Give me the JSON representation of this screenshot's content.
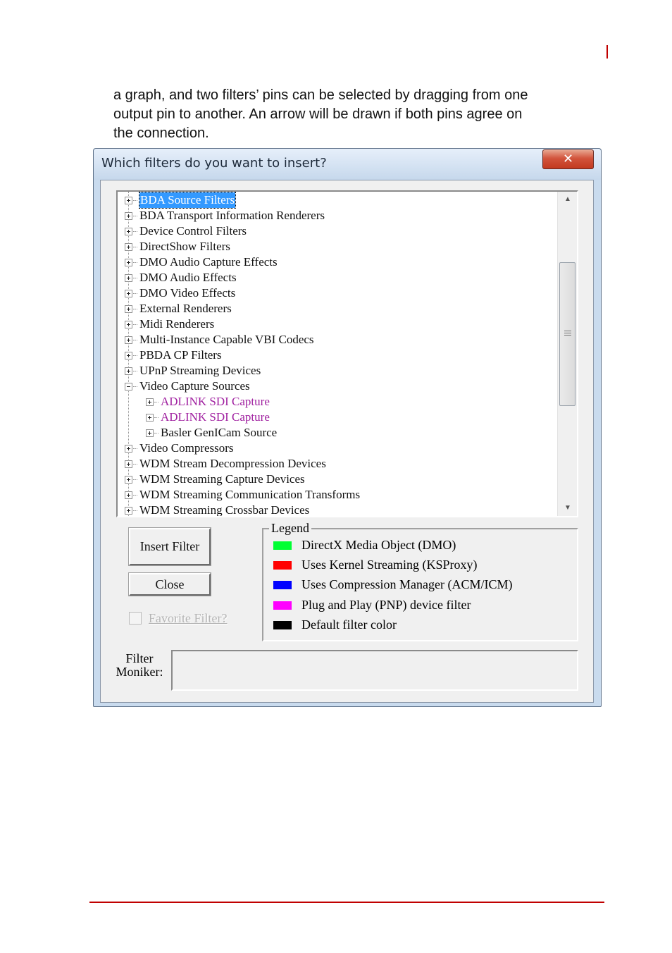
{
  "document": {
    "intro_lines": [
      "a graph, and two filters’ pins can be selected by dragging from one",
      "output pin to another. An arrow will be drawn if both pins agree on",
      "the connection."
    ]
  },
  "dialog": {
    "title": "Which filters do you want to insert?",
    "close_glyph": "✕",
    "tree": {
      "items": [
        {
          "label": "BDA Source Filters",
          "level": 0,
          "expander": "plus",
          "selected": true,
          "pnp": false
        },
        {
          "label": "BDA Transport Information Renderers",
          "level": 0,
          "expander": "plus",
          "selected": false,
          "pnp": false
        },
        {
          "label": "Device Control Filters",
          "level": 0,
          "expander": "plus",
          "selected": false,
          "pnp": false
        },
        {
          "label": "DirectShow Filters",
          "level": 0,
          "expander": "plus",
          "selected": false,
          "pnp": false
        },
        {
          "label": "DMO Audio Capture Effects",
          "level": 0,
          "expander": "plus",
          "selected": false,
          "pnp": false
        },
        {
          "label": "DMO Audio Effects",
          "level": 0,
          "expander": "plus",
          "selected": false,
          "pnp": false
        },
        {
          "label": "DMO Video Effects",
          "level": 0,
          "expander": "plus",
          "selected": false,
          "pnp": false
        },
        {
          "label": "External Renderers",
          "level": 0,
          "expander": "plus",
          "selected": false,
          "pnp": false
        },
        {
          "label": "Midi Renderers",
          "level": 0,
          "expander": "plus",
          "selected": false,
          "pnp": false
        },
        {
          "label": "Multi-Instance Capable VBI Codecs",
          "level": 0,
          "expander": "plus",
          "selected": false,
          "pnp": false
        },
        {
          "label": "PBDA CP Filters",
          "level": 0,
          "expander": "plus",
          "selected": false,
          "pnp": false
        },
        {
          "label": "UPnP Streaming Devices",
          "level": 0,
          "expander": "plus",
          "selected": false,
          "pnp": false
        },
        {
          "label": "Video Capture Sources",
          "level": 0,
          "expander": "minus",
          "selected": false,
          "pnp": false
        },
        {
          "label": "ADLINK SDI Capture",
          "level": 1,
          "expander": "plus",
          "selected": false,
          "pnp": true
        },
        {
          "label": "ADLINK SDI Capture",
          "level": 1,
          "expander": "plus",
          "selected": false,
          "pnp": true
        },
        {
          "label": "Basler GenICam Source",
          "level": 1,
          "expander": "plus",
          "selected": false,
          "pnp": false
        },
        {
          "label": "Video Compressors",
          "level": 0,
          "expander": "plus",
          "selected": false,
          "pnp": false
        },
        {
          "label": "WDM Stream Decompression Devices",
          "level": 0,
          "expander": "plus",
          "selected": false,
          "pnp": false
        },
        {
          "label": "WDM Streaming Capture Devices",
          "level": 0,
          "expander": "plus",
          "selected": false,
          "pnp": false
        },
        {
          "label": "WDM Streaming Communication Transforms",
          "level": 0,
          "expander": "plus",
          "selected": false,
          "pnp": false
        },
        {
          "label": "WDM Streaming Crossbar Devices",
          "level": 0,
          "expander": "plus",
          "selected": false,
          "pnp": false
        }
      ]
    },
    "buttons": {
      "insert_filter": "Insert Filter",
      "close": "Close"
    },
    "favorite_checkbox": {
      "label": "Favorite Filter?",
      "checked": false,
      "enabled": false
    },
    "legend": {
      "title": "Legend",
      "items": [
        {
          "color": "#00ff33",
          "label": "DirectX Media Object (DMO)"
        },
        {
          "color": "#ff0000",
          "label": "Uses Kernel Streaming (KSProxy)"
        },
        {
          "color": "#0000ff",
          "label": "Uses Compression Manager (ACM/ICM)"
        },
        {
          "color": "#ff00ff",
          "label": "Plug and Play (PNP) device filter"
        },
        {
          "color": "#000000",
          "label": "Default filter color"
        }
      ]
    },
    "moniker": {
      "label_line1": "Filter",
      "label_line2": "Moniker:",
      "value": ""
    }
  },
  "colors": {
    "accent_rule": "#c00000",
    "selection": "#3399ff",
    "pnp_text": "#a020a0"
  }
}
